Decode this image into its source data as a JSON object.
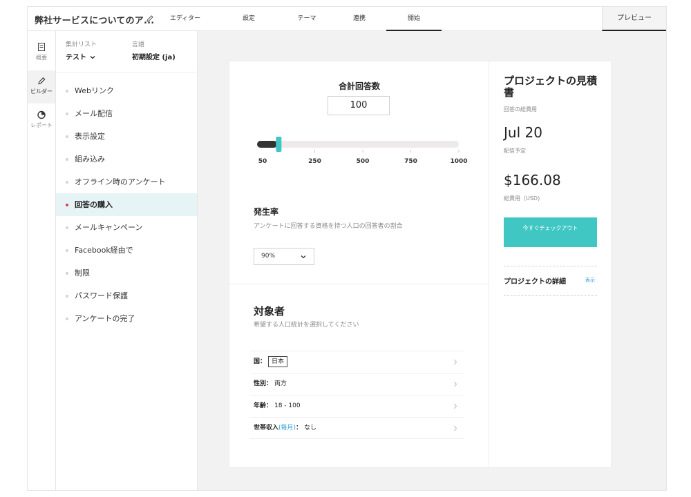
{
  "header": {
    "survey_title": "弊社サービスについてのア...",
    "tabs": [
      {
        "label": "エディター"
      },
      {
        "label": "設定"
      },
      {
        "label": "テーマ"
      },
      {
        "label": "連携"
      },
      {
        "label": "開始",
        "active": true
      }
    ],
    "preview_label": "プレビュー"
  },
  "rail": {
    "items": [
      {
        "label": "概要",
        "icon": "document-icon"
      },
      {
        "label": "ビルダー",
        "icon": "pencil-icon",
        "active": true
      },
      {
        "label": "レポート",
        "icon": "pie-chart-icon"
      }
    ]
  },
  "panel": {
    "list_caption": "集計リスト",
    "list_value": "テスト",
    "lang_caption": "言語",
    "lang_value": "初期設定 (ja)",
    "items": [
      {
        "label": "Webリンク"
      },
      {
        "label": "メール配信"
      },
      {
        "label": "表示設定"
      },
      {
        "label": "組み込み"
      },
      {
        "label": "オフライン時のアンケート"
      },
      {
        "label": "回答の購入",
        "active": true
      },
      {
        "label": "メールキャンペーン"
      },
      {
        "label": "Facebook経由で"
      },
      {
        "label": "制限"
      },
      {
        "label": "パスワード保護"
      },
      {
        "label": "アンケートの完了"
      }
    ]
  },
  "responses": {
    "label": "合計回答数",
    "value": "100",
    "slider": {
      "value": 100,
      "min": 50,
      "max": 1000,
      "ticks": [
        "50",
        "250",
        "500",
        "750",
        "1000"
      ]
    }
  },
  "incidence": {
    "title": "発生率",
    "description": "アンケートに回答する資格を持つ人口の回答者の割合",
    "selected": "90%"
  },
  "audience": {
    "title": "対象者",
    "description": "希望する人口統計を選択してください",
    "rows": [
      {
        "key": "国：",
        "value": "日本"
      },
      {
        "key": "性別：",
        "value": "両方"
      },
      {
        "key": "年齢：",
        "value": "18 - 100"
      },
      {
        "key": "世帯収入",
        "accent": "(毎月)",
        "key_suffix": "：",
        "value": "なし"
      }
    ]
  },
  "estimate": {
    "title": "プロジェクトの見積書",
    "subtitle": "回答の総費用",
    "date": "Jul 20",
    "date_caption": "配信予定",
    "price": "$166.08",
    "price_caption": "総費用（USD)",
    "checkout_label": "今すぐチェックアウト",
    "details_label": "プロジェクトの詳細",
    "details_link": "表示"
  },
  "colors": {
    "accent": "#40c7c4",
    "active_dot": "#e0364f",
    "link": "#2a9fd8",
    "active_row": "#e7f4f5"
  }
}
